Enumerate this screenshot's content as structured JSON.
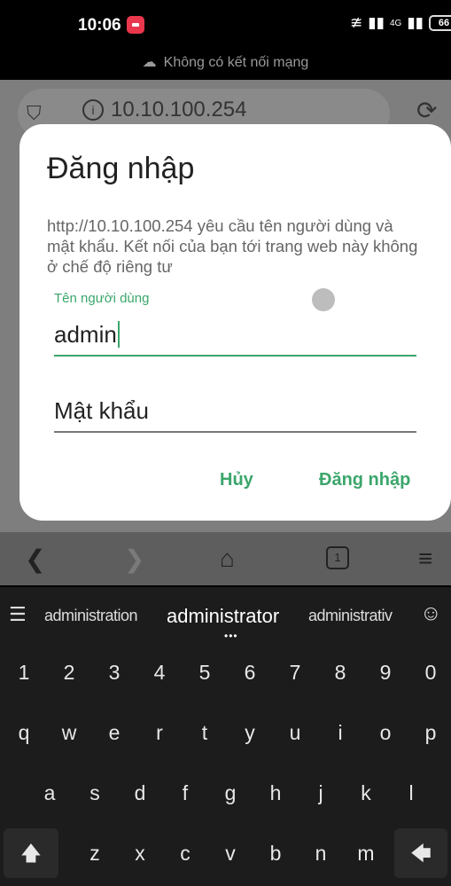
{
  "status_bar": {
    "time": "10:06",
    "signal_text": "4G",
    "battery": "66",
    "network_message": "Không có kết nối mạng"
  },
  "browser": {
    "url": "10.10.100.254",
    "shield_icon": "shield-icon",
    "info_icon": "i"
  },
  "dialog": {
    "title": "Đăng nhập",
    "message": "http://10.10.100.254 yêu cầu tên người dùng và mật khẩu. Kết nối của bạn tới trang web này không ở chế độ riêng tư",
    "username_label": "Tên người dùng",
    "username_value": "admin",
    "password_placeholder": "Mật khẩu",
    "cancel_label": "Hủy",
    "login_label": "Đăng nhập",
    "accent_color": "#3ba66b"
  },
  "navbar": {
    "tab_count": "1"
  },
  "keyboard": {
    "suggestions": [
      "administration",
      "administrator",
      "administrativ"
    ],
    "number_row": [
      "1",
      "2",
      "3",
      "4",
      "5",
      "6",
      "7",
      "8",
      "9",
      "0"
    ],
    "row_q": [
      "q",
      "w",
      "e",
      "r",
      "t",
      "y",
      "u",
      "i",
      "o",
      "p"
    ],
    "row_a": [
      "a",
      "s",
      "d",
      "f",
      "g",
      "h",
      "j",
      "k",
      "l"
    ],
    "row_z": [
      "z",
      "x",
      "c",
      "v",
      "b",
      "n",
      "m"
    ]
  }
}
